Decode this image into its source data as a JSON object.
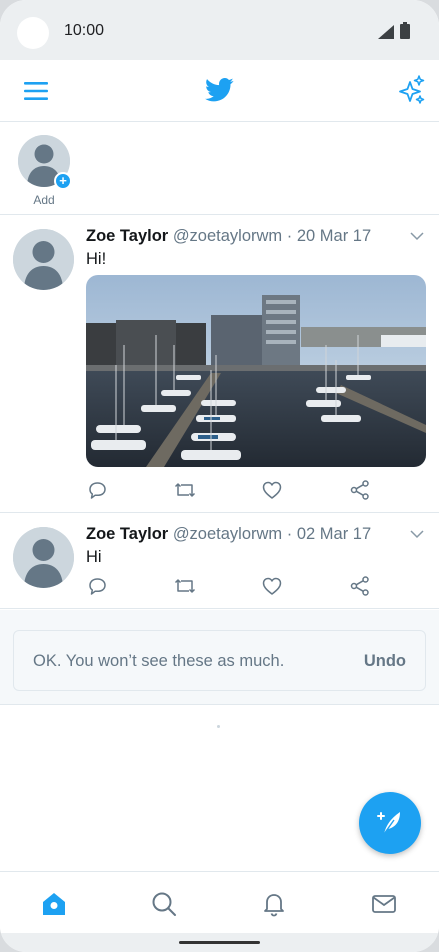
{
  "status_bar": {
    "time": "10:00"
  },
  "app_bar": {
    "menu_icon": "hamburger-menu-icon",
    "logo_icon": "twitter-bird-icon",
    "sparkle_icon": "sparkle-icon"
  },
  "fleets": {
    "add_label": "Add"
  },
  "tweets": [
    {
      "name": "Zoe Taylor",
      "handle": "@zoetaylorwm",
      "separator": " · ",
      "date": "20 Mar 17",
      "text": "Hi!",
      "has_photo": true
    },
    {
      "name": "Zoe Taylor",
      "handle": "@zoetaylorwm",
      "separator": " · ",
      "date": "02 Mar 17",
      "text": "Hi",
      "has_photo": false
    }
  ],
  "undo_notice": {
    "message": "OK. You won’t see these as much.",
    "undo_label": "Undo"
  },
  "fab": {
    "icon": "compose-tweet-icon"
  },
  "bottom_nav": [
    "home-icon",
    "search-icon",
    "notifications-icon",
    "messages-icon"
  ],
  "colors": {
    "brand": "#1da1f2",
    "text": "#14171a",
    "secondary": "#657786",
    "border": "#e1e8ed",
    "gray_bg": "#f5f8fa"
  }
}
